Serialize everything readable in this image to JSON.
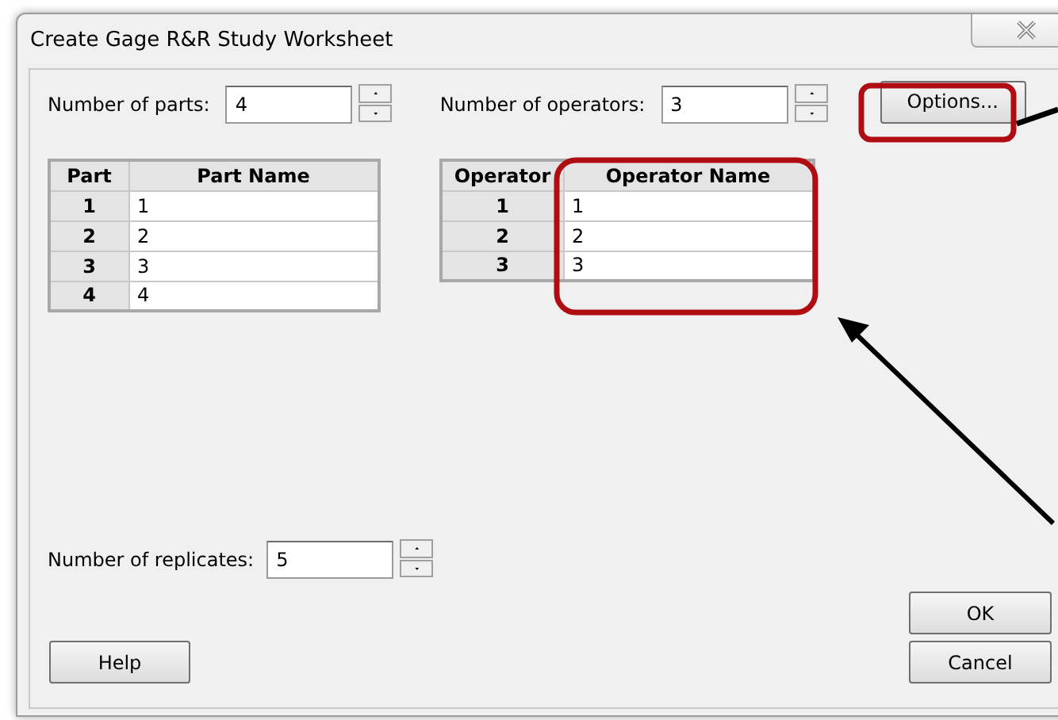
{
  "window": {
    "title": "Create Gage R&R Study Worksheet"
  },
  "fields": [
    {
      "label": "Number of parts:",
      "value": "4"
    },
    {
      "label": "Number of operators:",
      "value": "3"
    },
    {
      "label": "Number of replicates:",
      "value": "5"
    }
  ],
  "parts_table": {
    "columns": [
      "Part",
      "Part Name"
    ],
    "rows": [
      [
        "1",
        "1"
      ],
      [
        "2",
        "2"
      ],
      [
        "3",
        "3"
      ],
      [
        "4",
        "4"
      ]
    ]
  },
  "operators_table": {
    "columns": [
      "Operator",
      "Operator Name"
    ],
    "rows": [
      [
        "1",
        "1"
      ],
      [
        "2",
        "2"
      ],
      [
        "3",
        "3"
      ]
    ]
  },
  "buttons": {
    "options": "Options...",
    "ok": "OK",
    "cancel": "Cancel",
    "help": "Help"
  }
}
